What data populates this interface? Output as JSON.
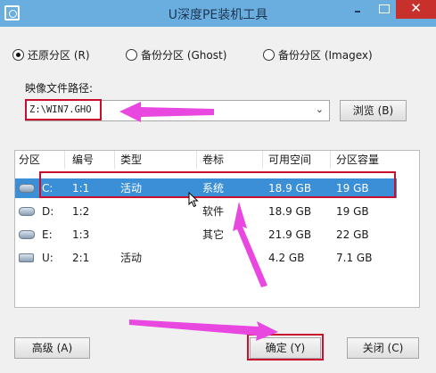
{
  "window": {
    "title": "U深度PE装机工具",
    "minimize_glyph": "–",
    "close_glyph": "✕"
  },
  "restore_mode": {
    "options": [
      {
        "label": "还原分区 (R)",
        "checked": true
      },
      {
        "label": "备份分区 (Ghost)",
        "checked": false
      },
      {
        "label": "备份分区 (Imagex)",
        "checked": false
      }
    ]
  },
  "image_path": {
    "label": "映像文件路径:",
    "value": "Z:\\WIN7.GHO",
    "chevron_glyph": "⌄",
    "browse_label": "浏览 (B)"
  },
  "partition_table": {
    "columns": [
      "分区",
      "编号",
      "类型",
      "卷标",
      "可用空间",
      "分区容量"
    ],
    "rows": [
      {
        "drive": "C:",
        "number": "1:1",
        "type": "活动",
        "label": "系统",
        "free": "18.9 GB",
        "size": "19 GB",
        "icon": "hdd-icon",
        "selected": true
      },
      {
        "drive": "D:",
        "number": "1:2",
        "type": "",
        "label": "软件",
        "free": "18.9 GB",
        "size": "19 GB",
        "icon": "hdd-icon",
        "selected": false
      },
      {
        "drive": "E:",
        "number": "1:3",
        "type": "",
        "label": "其它",
        "free": "21.9 GB",
        "size": "22 GB",
        "icon": "hdd-icon",
        "selected": false
      },
      {
        "drive": "U:",
        "number": "2:1",
        "type": "活动",
        "label": "",
        "free": "4.2 GB",
        "size": "7.1 GB",
        "icon": "usb-drive-icon",
        "selected": false
      }
    ]
  },
  "footer": {
    "advanced_label": "高级 (A)",
    "ok_label": "确定 (Y)",
    "close_label": "关闭 (C)"
  },
  "colors": {
    "titlebar": "#6aaee0",
    "selection": "#3b8fd6",
    "highlight_box": "#c8102e",
    "arrow": "#e848e0"
  }
}
